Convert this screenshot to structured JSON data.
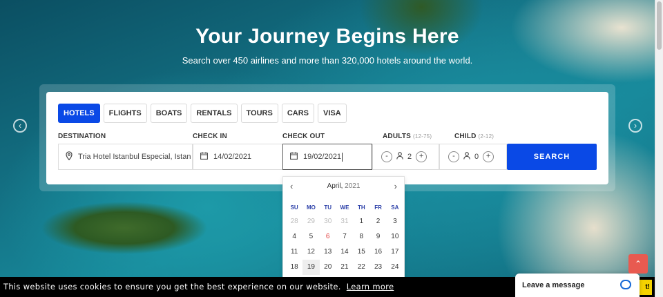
{
  "hero": {
    "title": "Your Journey Begins Here",
    "subtitle": "Search over 450 airlines and more than 320,000 hotels around the world."
  },
  "nav": {
    "prev_icon": "chevron-left-icon",
    "next_icon": "chevron-right-icon"
  },
  "tabs": [
    {
      "label": "HOTELS",
      "active": true
    },
    {
      "label": "FLIGHTS",
      "active": false
    },
    {
      "label": "BOATS",
      "active": false
    },
    {
      "label": "RENTALS",
      "active": false
    },
    {
      "label": "TOURS",
      "active": false
    },
    {
      "label": "CARS",
      "active": false
    },
    {
      "label": "VISA",
      "active": false
    }
  ],
  "form": {
    "destination_label": "DESTINATION",
    "destination_value": "Tria Hotel Istanbul Especial, Istan",
    "checkin_label": "CHECK IN",
    "checkin_value": "14/02/2021",
    "checkout_label": "CHECK OUT",
    "checkout_value": "19/02/2021",
    "adults_label": "ADULTS",
    "adults_range": "(12-75)",
    "adults_value": "2",
    "child_label": "CHILD",
    "child_range": "(2-12)",
    "child_value": "0",
    "minus": "-",
    "plus": "+",
    "search_label": "SEARCH"
  },
  "calendar": {
    "month": "April,",
    "year": "2021",
    "weekdays": [
      "SU",
      "MO",
      "TU",
      "WE",
      "TH",
      "FR",
      "SA"
    ],
    "days": [
      [
        "28",
        "29",
        "30",
        "31",
        "1",
        "2",
        "3"
      ],
      [
        "4",
        "5",
        "6",
        "7",
        "8",
        "9",
        "10"
      ],
      [
        "11",
        "12",
        "13",
        "14",
        "15",
        "16",
        "17"
      ],
      [
        "18",
        "19",
        "20",
        "21",
        "22",
        "23",
        "24"
      ]
    ],
    "muted_first_row_count": 4,
    "highlight_red": "6",
    "selected": "19"
  },
  "cookie": {
    "text": "This website uses cookies to ensure you get the best experience on our website.",
    "link": "Learn more",
    "button": "t!"
  },
  "chat": {
    "label": "Leave a message"
  },
  "colors": {
    "primary": "#0a49e6",
    "to_top": "#e85a50",
    "cookie_btn": "#f5d300"
  }
}
